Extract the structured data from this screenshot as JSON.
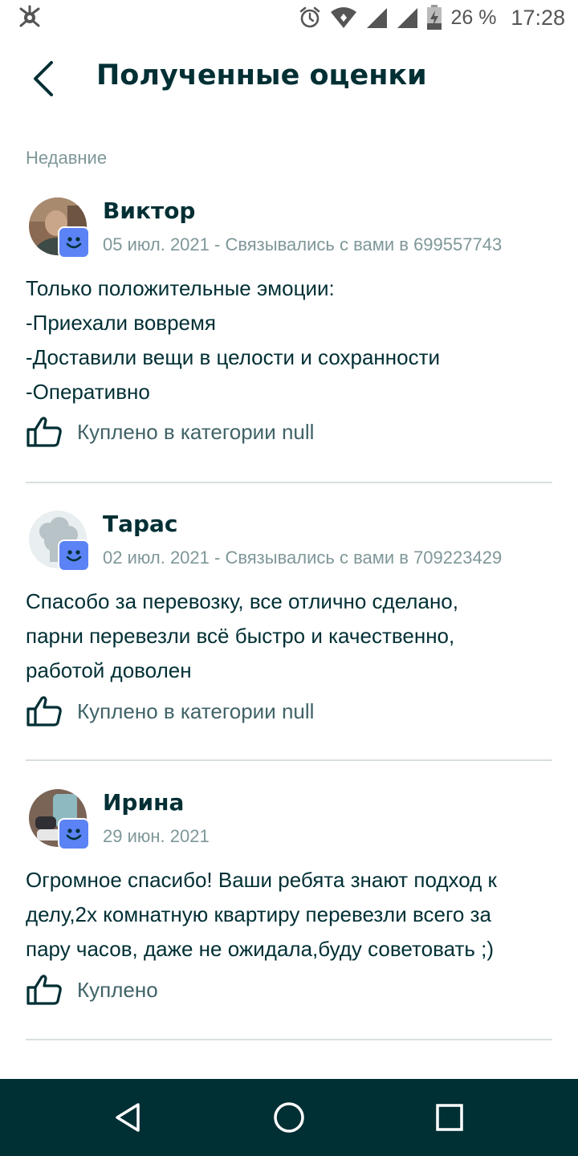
{
  "status_bar": {
    "battery_percent": "26 %",
    "time": "17:28",
    "icons": [
      "app-logo-icon",
      "alarm-icon",
      "wifi-icon",
      "signal-icon",
      "signal-icon",
      "battery-charging-icon"
    ]
  },
  "header": {
    "title": "Полученные оценки",
    "back_icon": "chevron-left-icon"
  },
  "section": {
    "label": "Недавние"
  },
  "reviews": [
    {
      "name": "Виктор",
      "meta": "05 июл. 2021 - Связывались с вами в 699557743",
      "text_lines": [
        "Только положительные эмоции:",
        "-Приехали вовремя",
        "-Доставили вещи в целости и сохранности",
        "-Оперативно"
      ],
      "purchase": "Куплено в категории null"
    },
    {
      "name": "Тарас",
      "meta": "02 июл. 2021 - Связывались с вами в 709223429",
      "text_lines": [
        "Спасобо за перевозку, все отлично сделано,",
        "парни перевезли всё быстро и качественно,",
        "работой доволен"
      ],
      "purchase": "Куплено в категории null"
    },
    {
      "name": "Ирина",
      "meta": "29 июн. 2021",
      "text_lines": [
        "Огромное спасибо! Ваши ребята знают подход к",
        "делу,2х комнатную квартиру перевезли всего за",
        "пару часов, даже не ожидала,буду советовать ;)"
      ],
      "purchase": "Куплено"
    }
  ],
  "nav_bar": {
    "icons": [
      "back-triangle-icon",
      "home-circle-icon",
      "recents-square-icon"
    ]
  },
  "colors": {
    "primary_text": "#002f34",
    "muted_text": "#7f9799",
    "badge_blue": "#5b83f5",
    "nav_bar": "#002f34"
  }
}
